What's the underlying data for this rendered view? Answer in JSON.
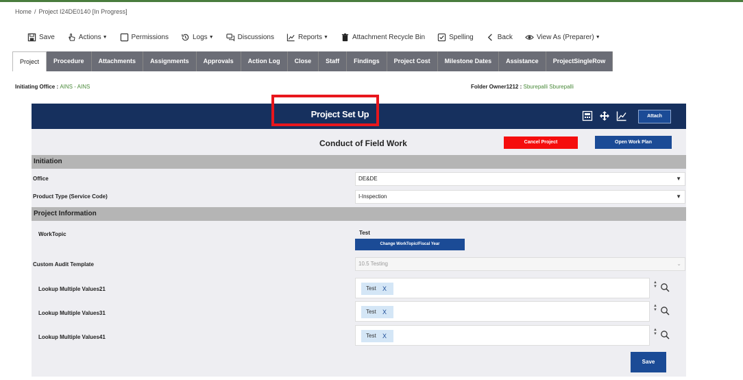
{
  "breadcrumb": {
    "home": "Home",
    "separator": "/",
    "project": "Project I24DE0140 [In Progress]"
  },
  "toolbar": [
    {
      "label": "Save",
      "icon": "save-icon",
      "caret": false
    },
    {
      "label": "Actions",
      "icon": "hand-icon",
      "caret": true
    },
    {
      "label": "Permissions",
      "icon": "square-icon",
      "caret": false
    },
    {
      "label": "Logs",
      "icon": "history-icon",
      "caret": true
    },
    {
      "label": "Discussions",
      "icon": "discussion-icon",
      "caret": false
    },
    {
      "label": "Reports",
      "icon": "chart-icon",
      "caret": true
    },
    {
      "label": "Attachment Recycle Bin",
      "icon": "trash-icon",
      "caret": false
    },
    {
      "label": "Spelling",
      "icon": "check-box-icon",
      "caret": false
    },
    {
      "label": "Back",
      "icon": "back-icon",
      "caret": false
    },
    {
      "label": "View As (Preparer)",
      "icon": "eye-icon",
      "caret": true
    }
  ],
  "tabs": [
    "Project",
    "Procedure",
    "Attachments",
    "Assignments",
    "Approvals",
    "Action Log",
    "Close",
    "Staff",
    "Findings",
    "Project Cost",
    "Milestone Dates",
    "Assistance",
    "ProjectSingleRow"
  ],
  "active_tab": "Project",
  "initiating_office": {
    "label": "Initiating Office :",
    "value": "AINS - AINS"
  },
  "folder_owner": {
    "label": "Folder Owner1212 :",
    "value": "Sburepalli Sburepalli"
  },
  "panel": {
    "title": "Project Set Up",
    "attach_label": "Attach",
    "subtitle": "Conduct of Field Work",
    "cancel_label": "Cancel Project",
    "open_plan_label": "Open Work Plan",
    "save_label": "Save"
  },
  "sections": {
    "initiation": "Initiation",
    "project_info": "Project Information"
  },
  "fields": {
    "office": {
      "label": "Office",
      "value": "DE&DE"
    },
    "product_type": {
      "label": "Product Type (Service Code)",
      "value": "I-Inspection"
    },
    "worktopic": {
      "label": "WorkTopic",
      "value": "Test",
      "button": "Change WorkTopic/Fiscal Year"
    },
    "custom_template": {
      "label": "Custom Audit Template",
      "value": "10.5 Testing"
    },
    "lookup21": {
      "label": "Lookup Multiple Values21",
      "chip": "Test",
      "remove": "X"
    },
    "lookup31": {
      "label": "Lookup Multiple Values31",
      "chip": "Test",
      "remove": "X"
    },
    "lookup41": {
      "label": "Lookup Multiple Values41",
      "chip": "Test",
      "remove": "X"
    }
  },
  "colors": {
    "header_navy": "#16305e",
    "button_blue": "#1b4b96",
    "cancel_red": "#f50d0d",
    "highlight_red": "#e8161c",
    "tab_gray": "#6b6d76"
  }
}
